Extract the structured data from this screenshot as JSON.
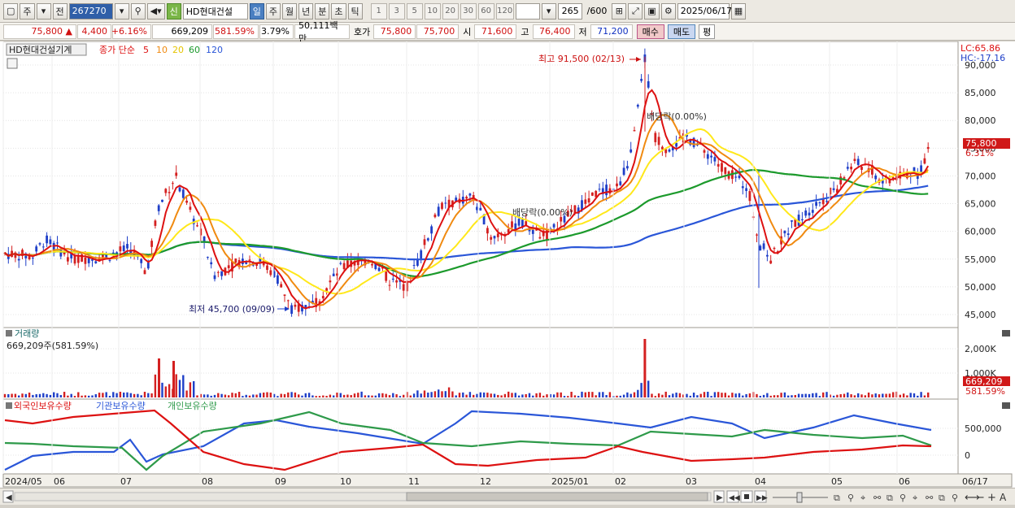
{
  "toolbar": {
    "market_label": "주",
    "prev_label": "전",
    "code": "267270",
    "name_badge": "신",
    "name": "HD현대건설",
    "period_tabs": [
      "일",
      "주",
      "월",
      "년",
      "분",
      "초",
      "틱"
    ],
    "active_period": "일",
    "intervals": [
      "1",
      "3",
      "5",
      "10",
      "20",
      "30",
      "60",
      "120"
    ],
    "count": "265",
    "count_total": "/600",
    "date": "2025/06/17"
  },
  "quote": {
    "price": "75,800",
    "arrow": "▲",
    "change": "4,400",
    "change_pct": "+6.16%",
    "volume": "669,209",
    "volume_pct": "581.59%",
    "turnover_pct": "3.79%",
    "amount": "50,111백만",
    "hoga_label": "호가",
    "ask": "75,800",
    "bid": "75,700",
    "open_label": "시",
    "open": "71,600",
    "high_label": "고",
    "high": "76,400",
    "low_label": "저",
    "low": "71,200",
    "buy_label": "매수",
    "sell_label": "매도",
    "eval_label": "평"
  },
  "price_panel": {
    "title": "HD현대건설기계",
    "ma_label": "종가 단순",
    "ma_periods": [
      "5",
      "10",
      "20",
      "60",
      "120"
    ],
    "lc": "LC:65.86",
    "hc": "HC:-17.16",
    "y_ticks": [
      "90,000",
      "85,000",
      "80,000",
      "75,000",
      "70,000",
      "65,000",
      "60,000",
      "55,000",
      "50,000",
      "45,000"
    ],
    "high_annotation": "최고 91,500 (02/13)",
    "low_annotation": "최저 45,700 (09/09)",
    "ex_div_1": "배당락(0.00%)",
    "ex_div_2": "배당락(0.00%)",
    "current_price": "75,800",
    "current_pct": "6.31%"
  },
  "volume_panel": {
    "title": "거래량",
    "value_text": "669,209주(581.59%)",
    "y_ticks": [
      "2,000K",
      "1,000K"
    ],
    "current": "669,209",
    "current_pct": "581.59%"
  },
  "holding_panel": {
    "legend": [
      "외국인보유수량",
      "기관보유수량",
      "개인보유수량"
    ],
    "y_ticks": [
      "500,000",
      "0"
    ]
  },
  "x_axis": {
    "labels": [
      "2024/05",
      "06",
      "07",
      "08",
      "09",
      "10",
      "11",
      "12",
      "2025/01",
      "02",
      "03",
      "04",
      "05",
      "06"
    ],
    "end_label": "06/17"
  },
  "colors": {
    "candle_up": "#d42020",
    "candle_down": "#1f3fc8",
    "ma5": "#dd1111",
    "ma10": "#f08a10",
    "ma20": "#ffe81a",
    "ma60": "#1c9a2c",
    "ma120": "#2a56d8",
    "foreign": "#dd1111",
    "institution": "#2a56d8",
    "individual": "#2e9a4a"
  }
}
